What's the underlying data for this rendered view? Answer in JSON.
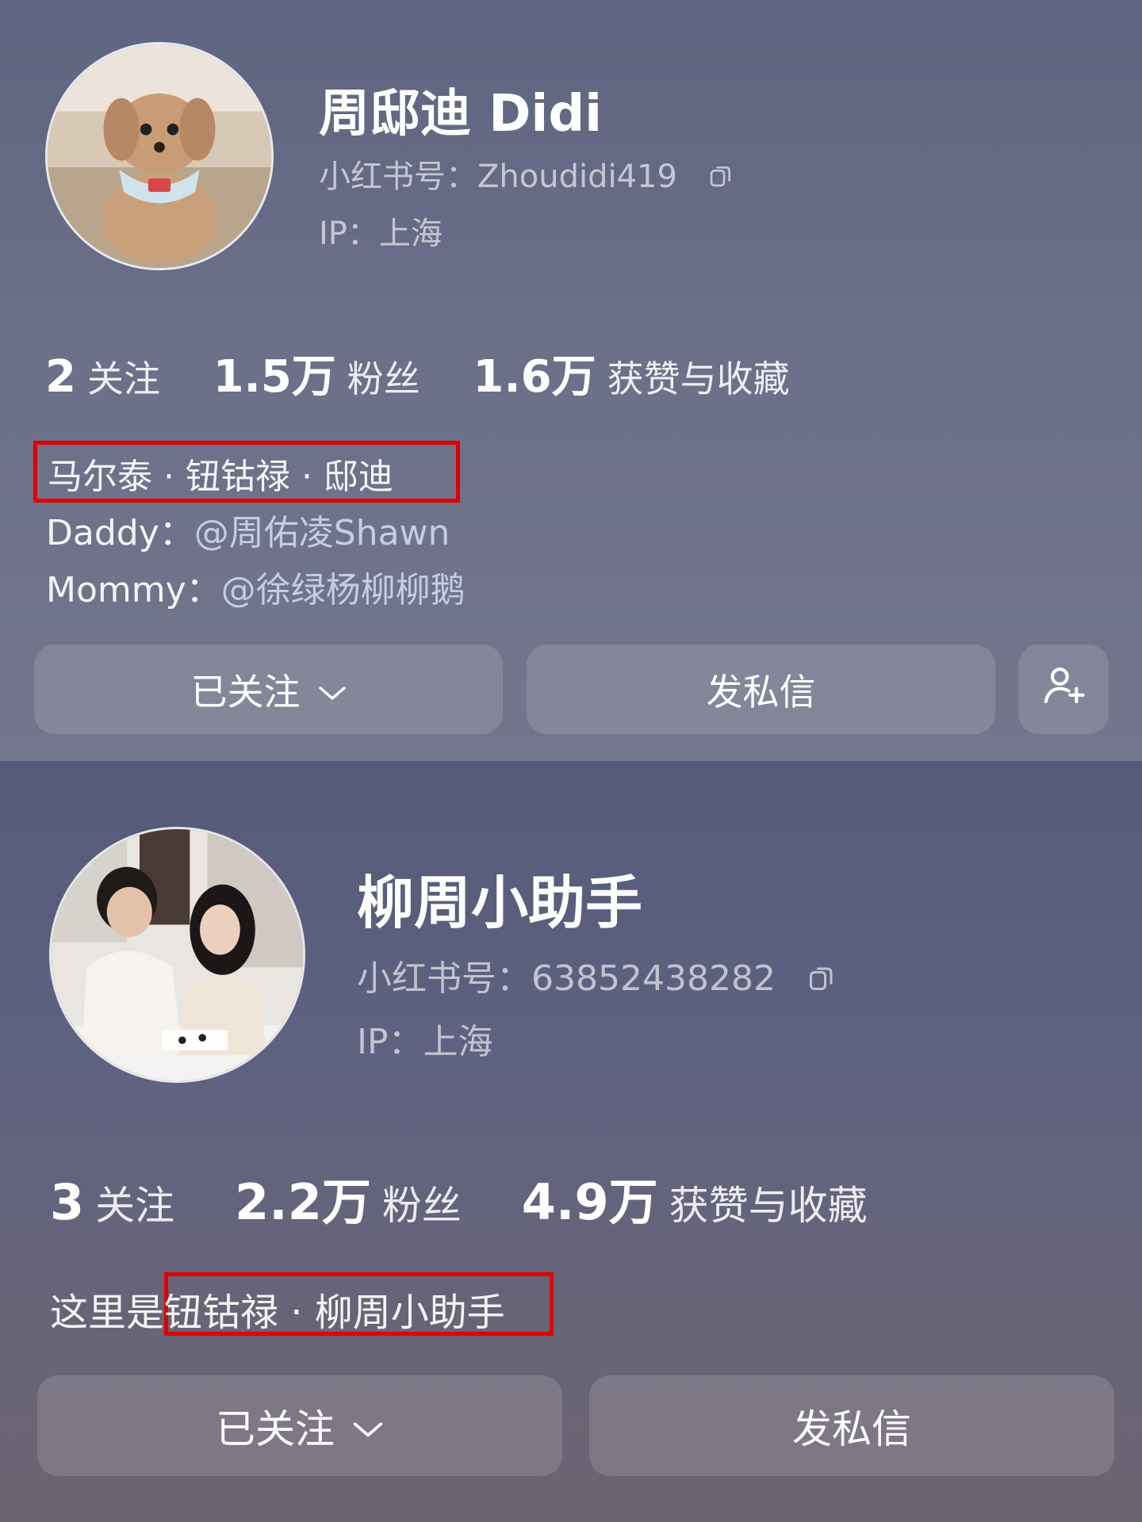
{
  "profile1": {
    "name": "周邸迪 Didi",
    "id_label": "小红书号：",
    "id_value": "Zhoudidi419",
    "ip": "IP：上海",
    "stats": [
      {
        "num": "2",
        "label": "关注"
      },
      {
        "num": "1.5万",
        "label": "粉丝"
      },
      {
        "num": "1.6万",
        "label": "获赞与收藏"
      }
    ],
    "bio_line1": "马尔泰 · 钮钴禄 · 邸迪",
    "bio_line2_prefix": "Daddy：",
    "bio_line2_mention": "@周佑凌Shawn",
    "bio_line3_prefix": "Mommy：",
    "bio_line3_mention": "@徐绿杨柳柳鹅",
    "follow_button": "已关注",
    "message_button": "发私信"
  },
  "profile2": {
    "name": "柳周小助手",
    "id_label": "小红书号：",
    "id_value": "63852438282",
    "ip": "IP：上海",
    "stats": [
      {
        "num": "3",
        "label": "关注"
      },
      {
        "num": "2.2万",
        "label": "粉丝"
      },
      {
        "num": "4.9万",
        "label": "获赞与收藏"
      }
    ],
    "bio_prefix": "这里是",
    "bio_highlight": "钮钴禄 · 柳周小助手",
    "follow_button": "已关注",
    "message_button": "发私信"
  },
  "icons": {
    "copy": "copy-icon",
    "chevron": "chevron-down-icon",
    "add_friend": "add-user-icon"
  },
  "colors": {
    "highlight_box": "#e00000",
    "mention": "#cdd7f0"
  }
}
